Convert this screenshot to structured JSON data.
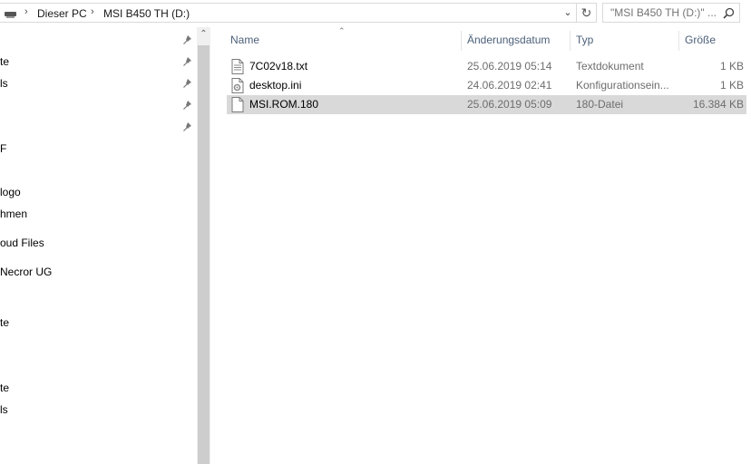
{
  "address_bar": {
    "breadcrumb": [
      "Dieser PC",
      "MSI B450 TH (D:)"
    ],
    "separator": "›",
    "dropdown_glyph": "⌄",
    "refresh_glyph": "↻",
    "drive_icon": "drive-icon"
  },
  "search": {
    "placeholder": "\"MSI B450 TH (D:)\" ...",
    "icon": "search-icon"
  },
  "nav_pane": {
    "items": [
      {
        "label": "te",
        "pinned": true
      },
      {
        "label": "ls",
        "pinned": true
      },
      {
        "label": "",
        "pinned": true
      },
      {
        "label": "F",
        "pinned": false
      },
      {
        "label": "logo",
        "pinned": false
      },
      {
        "label": "hmen",
        "pinned": false
      },
      {
        "label": "oud Files",
        "pinned": false
      },
      {
        "label": "Necror UG",
        "pinned": false
      },
      {
        "label": "te",
        "pinned": false
      },
      {
        "label": "te",
        "pinned": false
      },
      {
        "label": "ls",
        "pinned": false
      }
    ],
    "scroll_up_glyph": "⌃"
  },
  "file_list": {
    "columns": {
      "name": "Name",
      "date": "Änderungsdatum",
      "type": "Typ",
      "size": "Größe"
    },
    "sort_glyph": "⌃",
    "rows": [
      {
        "name": "7C02v18.txt",
        "date": "25.06.2019 05:14",
        "type": "Textdokument",
        "size": "1 KB",
        "icon": "text-file-icon",
        "selected": false
      },
      {
        "name": "desktop.ini",
        "date": "24.06.2019 02:41",
        "type": "Konfigurationsein...",
        "size": "1 KB",
        "icon": "settings-file-icon",
        "selected": false
      },
      {
        "name": "MSI.ROM.180",
        "date": "25.06.2019 05:09",
        "type": "180-Datei",
        "size": "16.384 KB",
        "icon": "blank-file-icon",
        "selected": true
      }
    ]
  },
  "colors": {
    "header_text": "#4c607a",
    "selected_row": "#d9d9d9",
    "detail_text": "#6d6d6d"
  }
}
